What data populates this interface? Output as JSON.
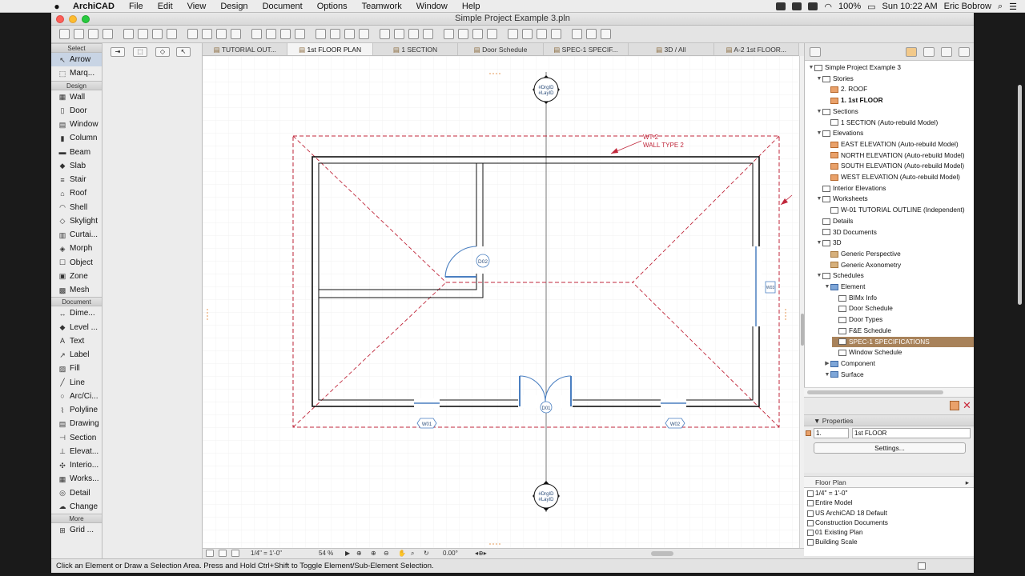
{
  "menubar": {
    "apple": "",
    "items": [
      "ArchiCAD",
      "File",
      "Edit",
      "View",
      "Design",
      "Document",
      "Options",
      "Teamwork",
      "Window",
      "Help"
    ],
    "battery": "100%",
    "clock": "Sun 10:22 AM",
    "user": "Eric Bobrow"
  },
  "window": {
    "title": "Simple Project Example 3.pln"
  },
  "toolbox": {
    "sections": [
      {
        "header": "Select",
        "tools": [
          {
            "label": "Arrow",
            "icon": "arrow-icon",
            "glyph": "↖"
          },
          {
            "label": "Marq...",
            "icon": "marquee-icon",
            "glyph": "⬚"
          }
        ]
      },
      {
        "header": "Design",
        "tools": [
          {
            "label": "Wall",
            "icon": "wall-icon",
            "glyph": "▦"
          },
          {
            "label": "Door",
            "icon": "door-icon",
            "glyph": "▯"
          },
          {
            "label": "Window",
            "icon": "window-icon",
            "glyph": "▤"
          },
          {
            "label": "Column",
            "icon": "column-icon",
            "glyph": "▮"
          },
          {
            "label": "Beam",
            "icon": "beam-icon",
            "glyph": "▬"
          },
          {
            "label": "Slab",
            "icon": "slab-icon",
            "glyph": "◆"
          },
          {
            "label": "Stair",
            "icon": "stair-icon",
            "glyph": "≡"
          },
          {
            "label": "Roof",
            "icon": "roof-icon",
            "glyph": "⌂"
          },
          {
            "label": "Shell",
            "icon": "shell-icon",
            "glyph": "◠"
          },
          {
            "label": "Skylight",
            "icon": "skylight-icon",
            "glyph": "◇"
          },
          {
            "label": "Curtai...",
            "icon": "curtain-wall-icon",
            "glyph": "▥"
          },
          {
            "label": "Morph",
            "icon": "morph-icon",
            "glyph": "◈"
          },
          {
            "label": "Object",
            "icon": "object-icon",
            "glyph": "☐"
          },
          {
            "label": "Zone",
            "icon": "zone-icon",
            "glyph": "▣"
          },
          {
            "label": "Mesh",
            "icon": "mesh-icon",
            "glyph": "▩"
          }
        ]
      },
      {
        "header": "Document",
        "tools": [
          {
            "label": "Dime...",
            "icon": "dimension-icon",
            "glyph": "↔"
          },
          {
            "label": "Level ...",
            "icon": "level-icon",
            "glyph": "◆"
          },
          {
            "label": "Text",
            "icon": "text-icon",
            "glyph": "A"
          },
          {
            "label": "Label",
            "icon": "label-icon",
            "glyph": "↗"
          },
          {
            "label": "Fill",
            "icon": "fill-icon",
            "glyph": "▨"
          },
          {
            "label": "Line",
            "icon": "line-icon",
            "glyph": "╱"
          },
          {
            "label": "Arc/Ci...",
            "icon": "arc-icon",
            "glyph": "○"
          },
          {
            "label": "Polyline",
            "icon": "polyline-icon",
            "glyph": "⌇"
          },
          {
            "label": "Drawing",
            "icon": "drawing-icon",
            "glyph": "▤"
          },
          {
            "label": "Section",
            "icon": "section-icon",
            "glyph": "⊣"
          },
          {
            "label": "Elevat...",
            "icon": "elevation-icon",
            "glyph": "⊥"
          },
          {
            "label": "Interio...",
            "icon": "interior-elevation-icon",
            "glyph": "✣"
          },
          {
            "label": "Works...",
            "icon": "worksheet-icon",
            "glyph": "▦"
          },
          {
            "label": "Detail",
            "icon": "detail-icon",
            "glyph": "◎"
          },
          {
            "label": "Change",
            "icon": "change-icon",
            "glyph": "☁"
          }
        ]
      },
      {
        "header": "More",
        "tools": [
          {
            "label": "Grid ...",
            "icon": "grid-icon",
            "glyph": "⊞"
          }
        ]
      }
    ]
  },
  "tabs": [
    {
      "label": "TUTORIAL OUT...",
      "icon": "worksheet-tab-icon"
    },
    {
      "label": "1st FLOOR PLAN",
      "icon": "floorplan-tab-icon",
      "active": true
    },
    {
      "label": "1 SECTION",
      "icon": "section-tab-icon"
    },
    {
      "label": "Door Schedule",
      "icon": "schedule-tab-icon"
    },
    {
      "label": "SPEC-1 SPECIF...",
      "icon": "schedule-tab-icon"
    },
    {
      "label": "3D / All",
      "icon": "3d-tab-icon"
    },
    {
      "label": "A-2 1st FLOOR...",
      "icon": "layout-tab-icon"
    }
  ],
  "canvas": {
    "wall_label_1": "WT-2",
    "wall_label_2": "WALL TYPE 2",
    "marker_top_1": "#DrgID",
    "marker_top_2": "#LayID",
    "marker_bottom_1": "#DrgID",
    "marker_bottom_2": "#LayID",
    "door_tag_1": "D02",
    "door_tag_2": "D01",
    "window_tag_1": "W01",
    "window_tag_2": "W02",
    "window_tag_3": "W03"
  },
  "canvasbar": {
    "scale": "1/4\"  =  1'-0\"",
    "zoom": "54 %",
    "angle": "0.00°"
  },
  "navigator": {
    "items": [
      {
        "label": "Simple Project Example 3",
        "level": 0,
        "toggle": "▼",
        "icon": "project"
      },
      {
        "label": "Stories",
        "level": 1,
        "toggle": "▼",
        "icon": "folder"
      },
      {
        "label": "2. ROOF",
        "level": 2,
        "toggle": "",
        "icon": "orange"
      },
      {
        "label": "1. 1st FLOOR",
        "level": 2,
        "toggle": "",
        "icon": "orange",
        "bold": true
      },
      {
        "label": "Sections",
        "level": 1,
        "toggle": "▼",
        "icon": "folder"
      },
      {
        "label": "1 SECTION (Auto-rebuild Model)",
        "level": 2,
        "toggle": "",
        "icon": "plain"
      },
      {
        "label": "Elevations",
        "level": 1,
        "toggle": "▼",
        "icon": "folder"
      },
      {
        "label": "EAST ELEVATION (Auto-rebuild Model)",
        "level": 2,
        "toggle": "",
        "icon": "orange"
      },
      {
        "label": "NORTH ELEVATION (Auto-rebuild Model)",
        "level": 2,
        "toggle": "",
        "icon": "orange"
      },
      {
        "label": "SOUTH ELEVATION (Auto-rebuild Model)",
        "level": 2,
        "toggle": "",
        "icon": "orange"
      },
      {
        "label": "WEST ELEVATION (Auto-rebuild Model)",
        "level": 2,
        "toggle": "",
        "icon": "orange"
      },
      {
        "label": "Interior Elevations",
        "level": 1,
        "toggle": "",
        "icon": "folder"
      },
      {
        "label": "Worksheets",
        "level": 1,
        "toggle": "▼",
        "icon": "folder"
      },
      {
        "label": "W-01 TUTORIAL OUTLINE (Independent)",
        "level": 2,
        "toggle": "",
        "icon": "plain"
      },
      {
        "label": "Details",
        "level": 1,
        "toggle": "",
        "icon": "folder"
      },
      {
        "label": "3D Documents",
        "level": 1,
        "toggle": "",
        "icon": "folder"
      },
      {
        "label": "3D",
        "level": 1,
        "toggle": "▼",
        "icon": "folder"
      },
      {
        "label": "Generic Perspective",
        "level": 2,
        "toggle": "",
        "icon": "tan"
      },
      {
        "label": "Generic Axonometry",
        "level": 2,
        "toggle": "",
        "icon": "tan"
      },
      {
        "label": "Schedules",
        "level": 1,
        "toggle": "▼",
        "icon": "folder"
      },
      {
        "label": "Element",
        "level": 2,
        "toggle": "▼",
        "icon": "blue"
      },
      {
        "label": "BIMx Info",
        "level": 3,
        "toggle": "",
        "icon": "plain"
      },
      {
        "label": "Door Schedule",
        "level": 3,
        "toggle": "",
        "icon": "plain"
      },
      {
        "label": "Door Types",
        "level": 3,
        "toggle": "",
        "icon": "plain"
      },
      {
        "label": "F&E Schedule",
        "level": 3,
        "toggle": "",
        "icon": "plain"
      },
      {
        "label": "SPEC-1 SPECIFICATIONS",
        "level": 3,
        "toggle": "",
        "icon": "plain",
        "selected": true
      },
      {
        "label": "Window Schedule",
        "level": 3,
        "toggle": "",
        "icon": "plain"
      },
      {
        "label": "Component",
        "level": 2,
        "toggle": "▶",
        "icon": "blue"
      },
      {
        "label": "Surface",
        "level": 2,
        "toggle": "▼",
        "icon": "blue"
      }
    ]
  },
  "properties": {
    "header": "Properties",
    "id_value": "1.",
    "name_value": "1st FLOOR",
    "settings_label": "Settings..."
  },
  "org_panel": {
    "header": "Floor Plan",
    "rows": [
      "1/4\"   =   1'-0\"",
      "Entire Model",
      "US ArchiCAD 18 Default",
      "Construction Documents",
      "01 Existing Plan",
      "Building Scale"
    ]
  },
  "statusbar": {
    "text": "Click an Element or Draw a Selection Area. Press and Hold Ctrl+Shift to Toggle Element/Sub-Element Selection."
  },
  "colors": {
    "accent_red": "#c0273b",
    "selection": "#a8825a",
    "door_blue": "#4a7fc1"
  }
}
